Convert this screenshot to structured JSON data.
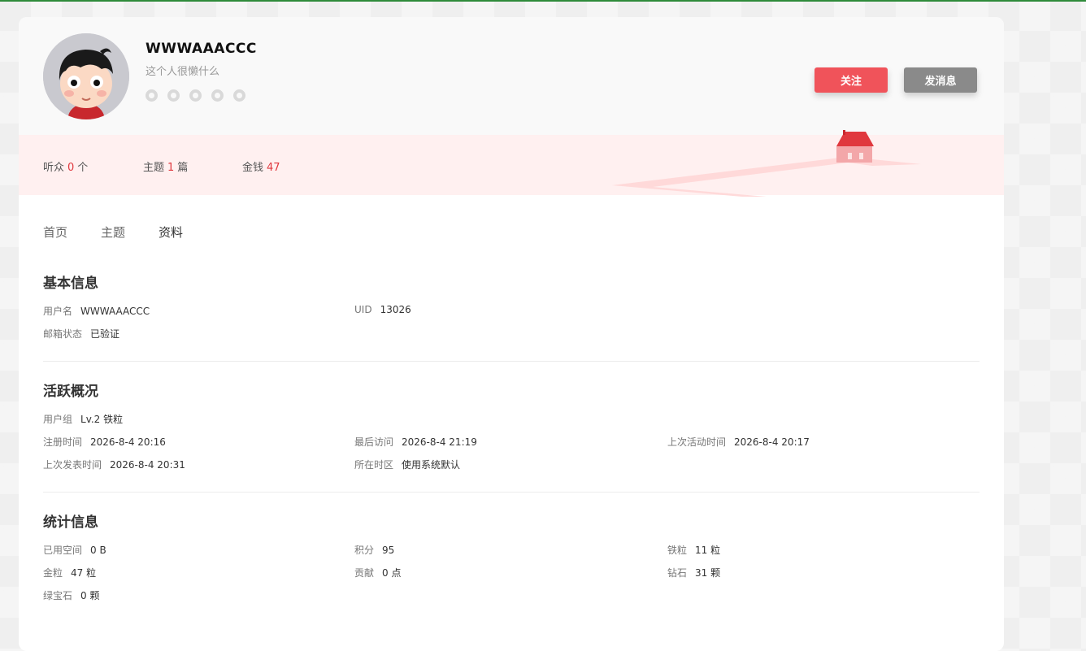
{
  "user": {
    "name": "WWWAAACCC",
    "bio": "这个人很懒什么"
  },
  "social_icons": [
    "qq-icon",
    "weibo-icon",
    "wechat-icon",
    "github-icon",
    "weixin-icon"
  ],
  "actions": {
    "follow_label": "关注",
    "message_label": "发消息"
  },
  "stats": {
    "listeners_label": "听众",
    "listeners_value": "0",
    "listeners_unit": "个",
    "topics_label": "主题",
    "topics_value": "1",
    "topics_unit": "篇",
    "money_label": "金钱",
    "money_value": "47"
  },
  "tabs": [
    {
      "label": "首页"
    },
    {
      "label": "主题"
    },
    {
      "label": "资料",
      "active": true
    }
  ],
  "basic": {
    "title": "基本信息",
    "username_label": "用户名",
    "username_value": "WWWAAACCC",
    "uid_label": "UID",
    "uid_value": "13026",
    "email_label": "邮箱状态",
    "email_value": "已验证"
  },
  "activity": {
    "title": "活跃概况",
    "group_label": "用户组",
    "group_value": "Lv.2 铁粒",
    "reg_label": "注册时间",
    "reg_value": "2026-8-4 20:16",
    "last_visit_label": "最后访问",
    "last_visit_value": "2026-8-4 21:19",
    "last_active_label": "上次活动时间",
    "last_active_value": "2026-8-4 20:17",
    "last_post_label": "上次发表时间",
    "last_post_value": "2026-8-4 20:31",
    "tz_label": "所在时区",
    "tz_value": "使用系统默认"
  },
  "statistics": {
    "title": "统计信息",
    "space_label": "已用空间",
    "space_value": "0 B",
    "points_label": "积分",
    "points_value": "95",
    "iron_label": "铁粒",
    "iron_value": "11 粒",
    "gold_label": "金粒",
    "gold_value": "47 粒",
    "contrib_label": "贡献",
    "contrib_value": "0 点",
    "diamond_label": "钻石",
    "diamond_value": "31 颗",
    "emerald_label": "绿宝石",
    "emerald_value": "0 颗"
  },
  "colors": {
    "accent": "#e0383e",
    "follow_button": "#f0535a",
    "message_button": "#8a8a8a",
    "stats_band": "#fff0f0"
  }
}
